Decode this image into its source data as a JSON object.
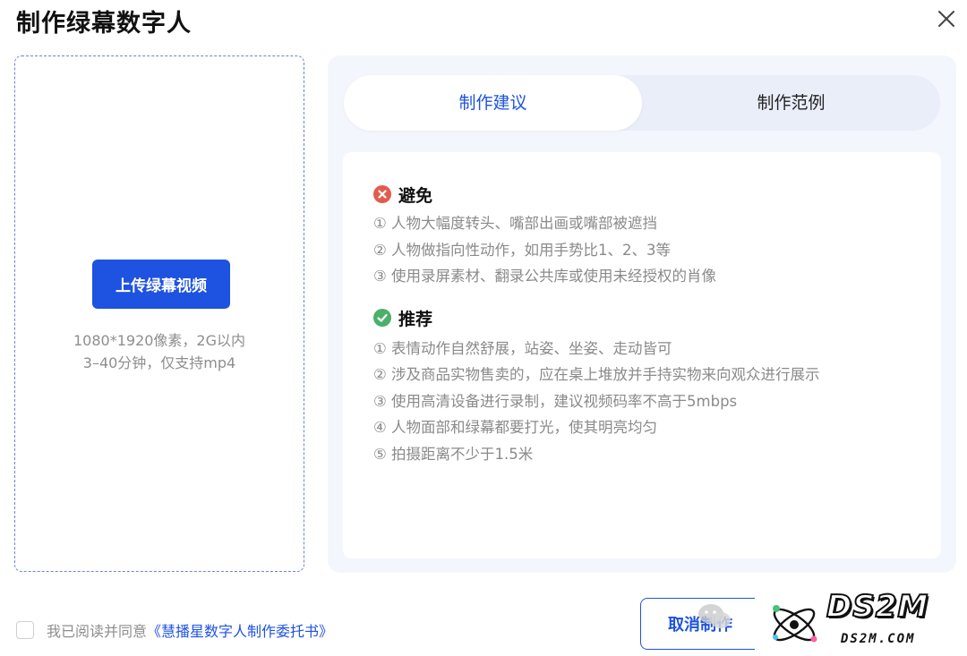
{
  "dialog": {
    "title": "制作绿幕数字人"
  },
  "upload": {
    "button_label": "上传绿幕视频",
    "hint_line1": "1080*1920像素，2G以内",
    "hint_line2": "3–40分钟，仅支持mp4"
  },
  "tabs": [
    {
      "label": "制作建议",
      "active": true
    },
    {
      "label": "制作范例",
      "active": false
    }
  ],
  "avoid": {
    "title": "避免",
    "icon": "error-circle-icon",
    "icon_color": "#e25c4e",
    "items": [
      "① 人物大幅度转头、嘴部出画或嘴部被遮挡",
      "② 人物做指向性动作，如用手势比1、2、3等",
      "③ 使用录屏素材、翻录公共库或使用未经授权的肖像"
    ]
  },
  "recommend": {
    "title": "推荐",
    "icon": "check-circle-icon",
    "icon_color": "#4caf6a",
    "items": [
      "① 表情动作自然舒展，站姿、坐姿、走动皆可",
      "② 涉及商品实物售卖的，应在桌上堆放并手持实物来向观众进行展示",
      "③ 使用高清设备进行录制，建议视频码率不高于5mbps",
      "④ 人物面部和绿幕都要打光，使其明亮均匀",
      "⑤ 拍摄距离不少于1.5米"
    ]
  },
  "footer": {
    "agree_text": "我已阅读并同意",
    "agree_link": "《慧播星数字人制作委托书》",
    "cancel_label": "取消制作",
    "agreed": false
  },
  "watermark": {
    "brand": "DS2M",
    "domain": "DS2M.COM"
  },
  "colors": {
    "accent": "#1e52e0",
    "panel_bg": "#f3f6fc",
    "muted_text": "#8a8a8a"
  }
}
